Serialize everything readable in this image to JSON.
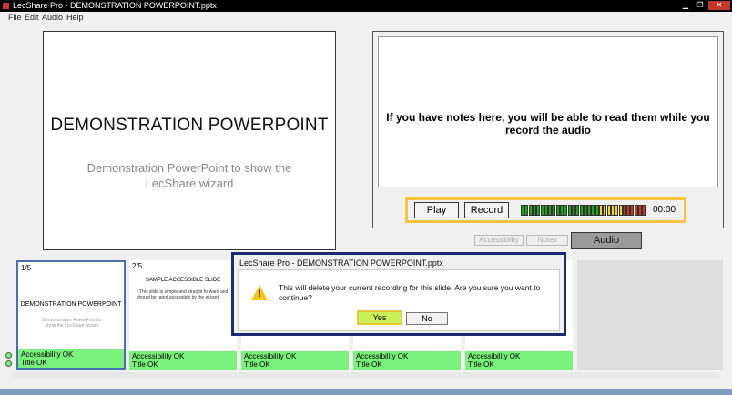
{
  "window": {
    "title": "LecShare Pro - DEMONSTRATION POWERPOINT.pptx",
    "minimize": "▁",
    "maximize": "❐",
    "close": "✕"
  },
  "menu": [
    {
      "label": "File"
    },
    {
      "label": "Edit"
    },
    {
      "label": "Audio"
    },
    {
      "label": "Help"
    }
  ],
  "slide": {
    "title": "DEMONSTRATION POWERPOINT",
    "subtitle": "Demonstration PowerPoint to show the LecShare wizard"
  },
  "notes": {
    "text": "If you have notes here, you will be able to read them while you record the audio"
  },
  "audio_controls": {
    "play_label": "Play",
    "record_label": "Record",
    "time": "00:00",
    "meter_colors": [
      "#22a022",
      "#22a022",
      "#22a022",
      "#22a022",
      "#22a022",
      "#22a022",
      "#22a022",
      "#22a022",
      "#22a022",
      "#22a022",
      "#22a022",
      "#22a022",
      "#22a022",
      "#22a022",
      "#22a022",
      "#22a022",
      "#22a022",
      "#22a022",
      "#22a022",
      "#22a022",
      "#f4d03f",
      "#f4d03f",
      "#f4d03f",
      "#f4d03f",
      "#f4d03f",
      "#f4d03f",
      "#c0392b",
      "#c0392b",
      "#c0392b",
      "#c0392b",
      "#c0392b",
      "#c0392b"
    ]
  },
  "tabs": {
    "accessibility": "Accessibility",
    "notes": "Notes",
    "audio": "Audio"
  },
  "thumbnails": [
    {
      "number": "1/5",
      "title": "DEMONSTRATION POWERPOINT",
      "subtitle": "Demonstration PowerPoint to show the LecShare wizard",
      "status1": "Accessibility OK",
      "status2": "Title OK"
    },
    {
      "number": "2/5",
      "title": "SAMPLE ACCESSIBLE SLIDE",
      "body": "• This slide is simple and straight forward and should be rated accessible by the wizard",
      "status1": "Accessibility OK",
      "status2": "Title OK"
    },
    {
      "status1": "Accessibility OK",
      "status2": "Title OK"
    },
    {
      "status1": "Accessibility OK",
      "status2": "Title OK"
    },
    {
      "status1": "Accessibility OK",
      "status2": "Title OK"
    }
  ],
  "dialog": {
    "title": "LecShare Pro - DEMONSTRATION POWERPOINT.pptx",
    "message": "This will delete your current recording for this slide.  Are you sure you want to continue?",
    "yes_label": "Yes",
    "no_label": "No"
  },
  "colors": {
    "status_ok": "#7cf07c",
    "selected_border": "#4a6fb5",
    "dialog_border": "#1e2a6e",
    "highlight": "#f5c242"
  },
  "icons": {
    "warning": "warning-icon",
    "ok_dot": "status-ok-icon"
  }
}
